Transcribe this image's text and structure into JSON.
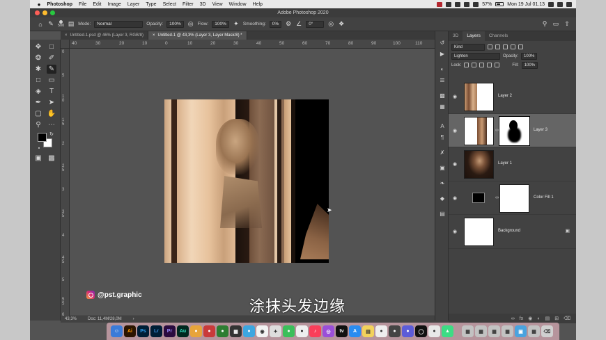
{
  "colors": {
    "ps_blue": "#2fa3f7",
    "ai_orange": "#ff9a00",
    "lr_blue": "#3b8ad8",
    "pr_purple": "#9a8cff",
    "au_teal": "#34e1c2"
  },
  "menubar": {
    "app_name": "Photoshop",
    "items": [
      "File",
      "Edit",
      "Image",
      "Layer",
      "Type",
      "Select",
      "Filter",
      "3D",
      "View",
      "Window",
      "Help"
    ],
    "battery": "57%",
    "clock": "Mon 19 Jul  01.13"
  },
  "window": {
    "title": "Adobe Photoshop 2020"
  },
  "options": {
    "brush_size": "500",
    "mode_label": "Mode:",
    "mode_value": "Normal",
    "opacity_label": "Opacity:",
    "opacity_value": "100%",
    "flow_label": "Flow:",
    "flow_value": "100%",
    "smoothing_label": "Smoothing:",
    "smoothing_value": "0%",
    "angle_value": "0°"
  },
  "tabs": [
    {
      "label": "Untitled-1.psd @ 46% (Layer 3, RGB/8)"
    },
    {
      "label": "Untitled-1 @ 43,3% (Layer 3, Layer Mask/8) *"
    }
  ],
  "ruler": {
    "h_labels": [
      "40",
      "30",
      "20",
      "10",
      "0",
      "10",
      "20",
      "30",
      "40",
      "50",
      "60",
      "70",
      "80",
      "90",
      "100",
      "110"
    ],
    "v_labels": [
      "0",
      "5",
      "1 0",
      "1 5",
      "2",
      "2 5",
      "3",
      "3 5",
      "4",
      "4 5",
      "5",
      "5 5",
      "6"
    ]
  },
  "status": {
    "zoom": "43,3%",
    "doc": "Doc: 11,4M/28,0M"
  },
  "overlay": {
    "handle": "@pst.graphic",
    "subtitle": "涂抹头发边缘"
  },
  "panel": {
    "tabs": [
      "3D",
      "Layers",
      "Channels"
    ],
    "kind_label": "Kind",
    "blend_mode": "Lighten",
    "opacity_label": "Opacity:",
    "opacity_value": "100%",
    "lock_label": "Lock:",
    "fill_label": "Fill:",
    "fill_value": "100%",
    "layers": [
      {
        "name": "Layer 2"
      },
      {
        "name": "Layer 3"
      },
      {
        "name": "Layer 1"
      },
      {
        "name": "Color Fill 1"
      },
      {
        "name": "Background"
      }
    ]
  },
  "dock": {
    "apps": [
      "Ai",
      "Ps",
      "Lr",
      "Pr",
      "Au"
    ]
  }
}
